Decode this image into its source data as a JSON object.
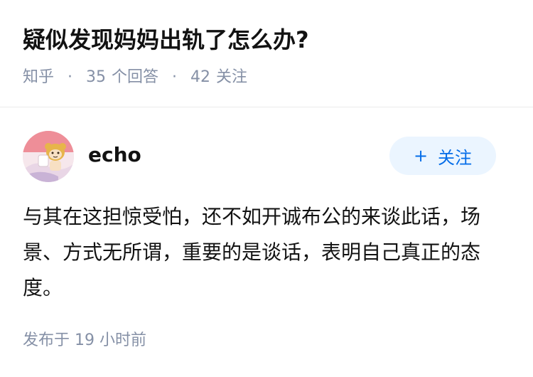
{
  "question": {
    "title": "疑似发现妈妈出轨了怎么办?",
    "source": "知乎",
    "answer_count": "35",
    "answer_label": "个回答",
    "follow_count": "42",
    "follow_label": "关注"
  },
  "answer": {
    "author": {
      "name": "echo",
      "avatar_icon": "anime-avatar-icon"
    },
    "follow_button": {
      "icon": "plus-icon",
      "label": "关注"
    },
    "content": "与其在这担惊受怕，还不如开诚布公的来谈此话，场景、方式无所谓，重要的是谈话，表明自己真正的态度。",
    "published_label": "发布于",
    "published_time": "19 小时前"
  },
  "colors": {
    "accent": "#056de8",
    "accent_bg": "#ebf5ff",
    "meta_text": "#8590a6",
    "main_text": "#121212"
  }
}
